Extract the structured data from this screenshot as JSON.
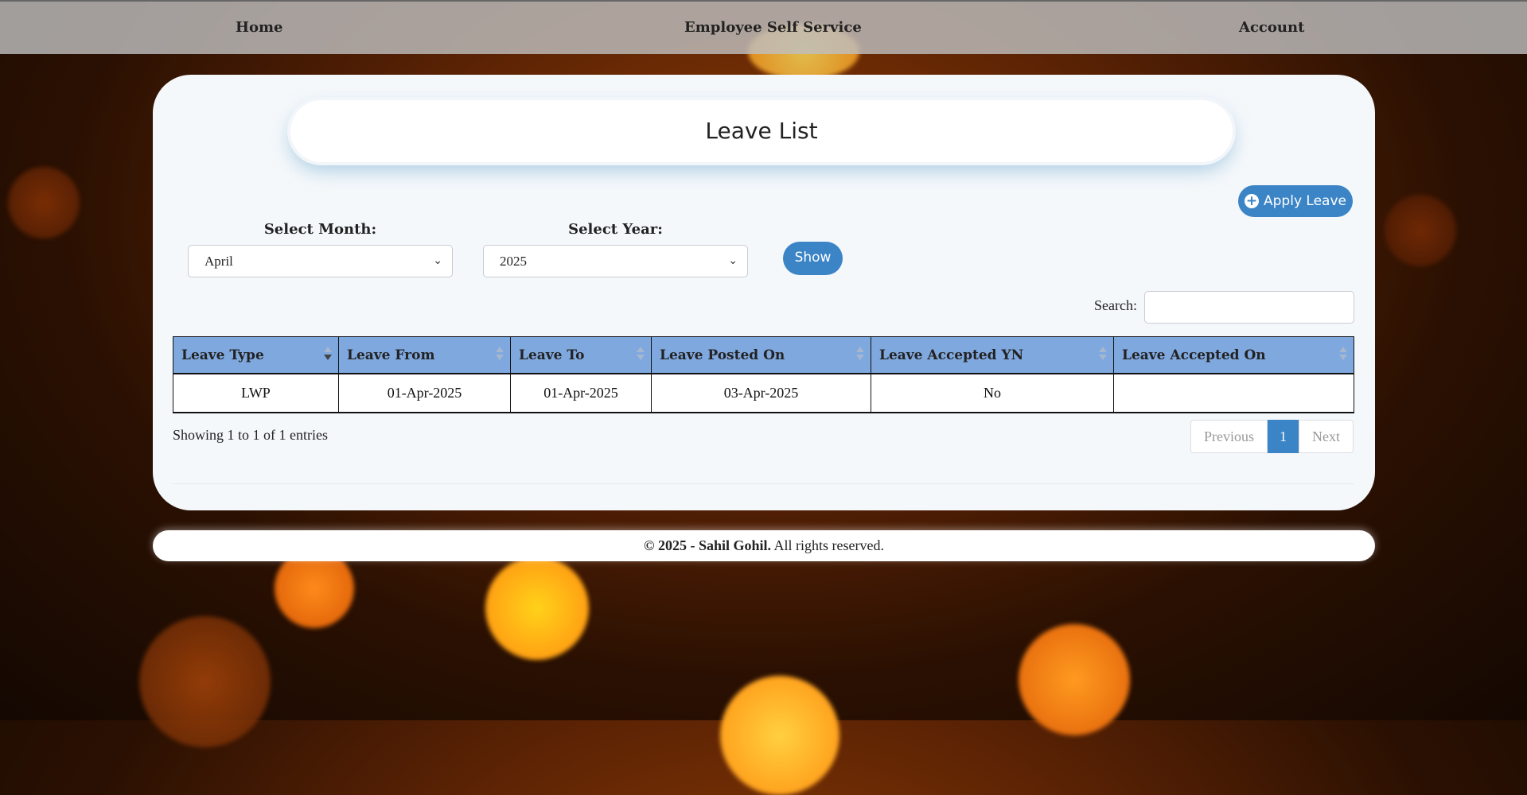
{
  "nav": {
    "home": "Home",
    "brand": "Employee Self Service",
    "account": "Account"
  },
  "page": {
    "title": "Leave List"
  },
  "apply_button": {
    "label": "Apply Leave",
    "icon": "plus-circle-icon"
  },
  "filters": {
    "month_label": "Select Month:",
    "month_value": "April",
    "year_label": "Select Year:",
    "year_value": "2025",
    "show_label": "Show"
  },
  "search": {
    "label": "Search:",
    "value": ""
  },
  "table": {
    "columns": [
      "Leave Type",
      "Leave From",
      "Leave To",
      "Leave Posted On",
      "Leave Accepted YN",
      "Leave Accepted On"
    ],
    "rows": [
      [
        "LWP",
        "01-Apr-2025",
        "01-Apr-2025",
        "03-Apr-2025",
        "No",
        ""
      ]
    ]
  },
  "info": "Showing 1 to 1 of 1 entries",
  "pagination": {
    "previous": "Previous",
    "current": "1",
    "next": "Next"
  },
  "footer": {
    "copyright": "© 2025 - ",
    "author": "Sahil Gohil.",
    "rights": " All rights reserved."
  },
  "colors": {
    "accent": "#3b84c6",
    "table_header": "#7fa8df"
  }
}
